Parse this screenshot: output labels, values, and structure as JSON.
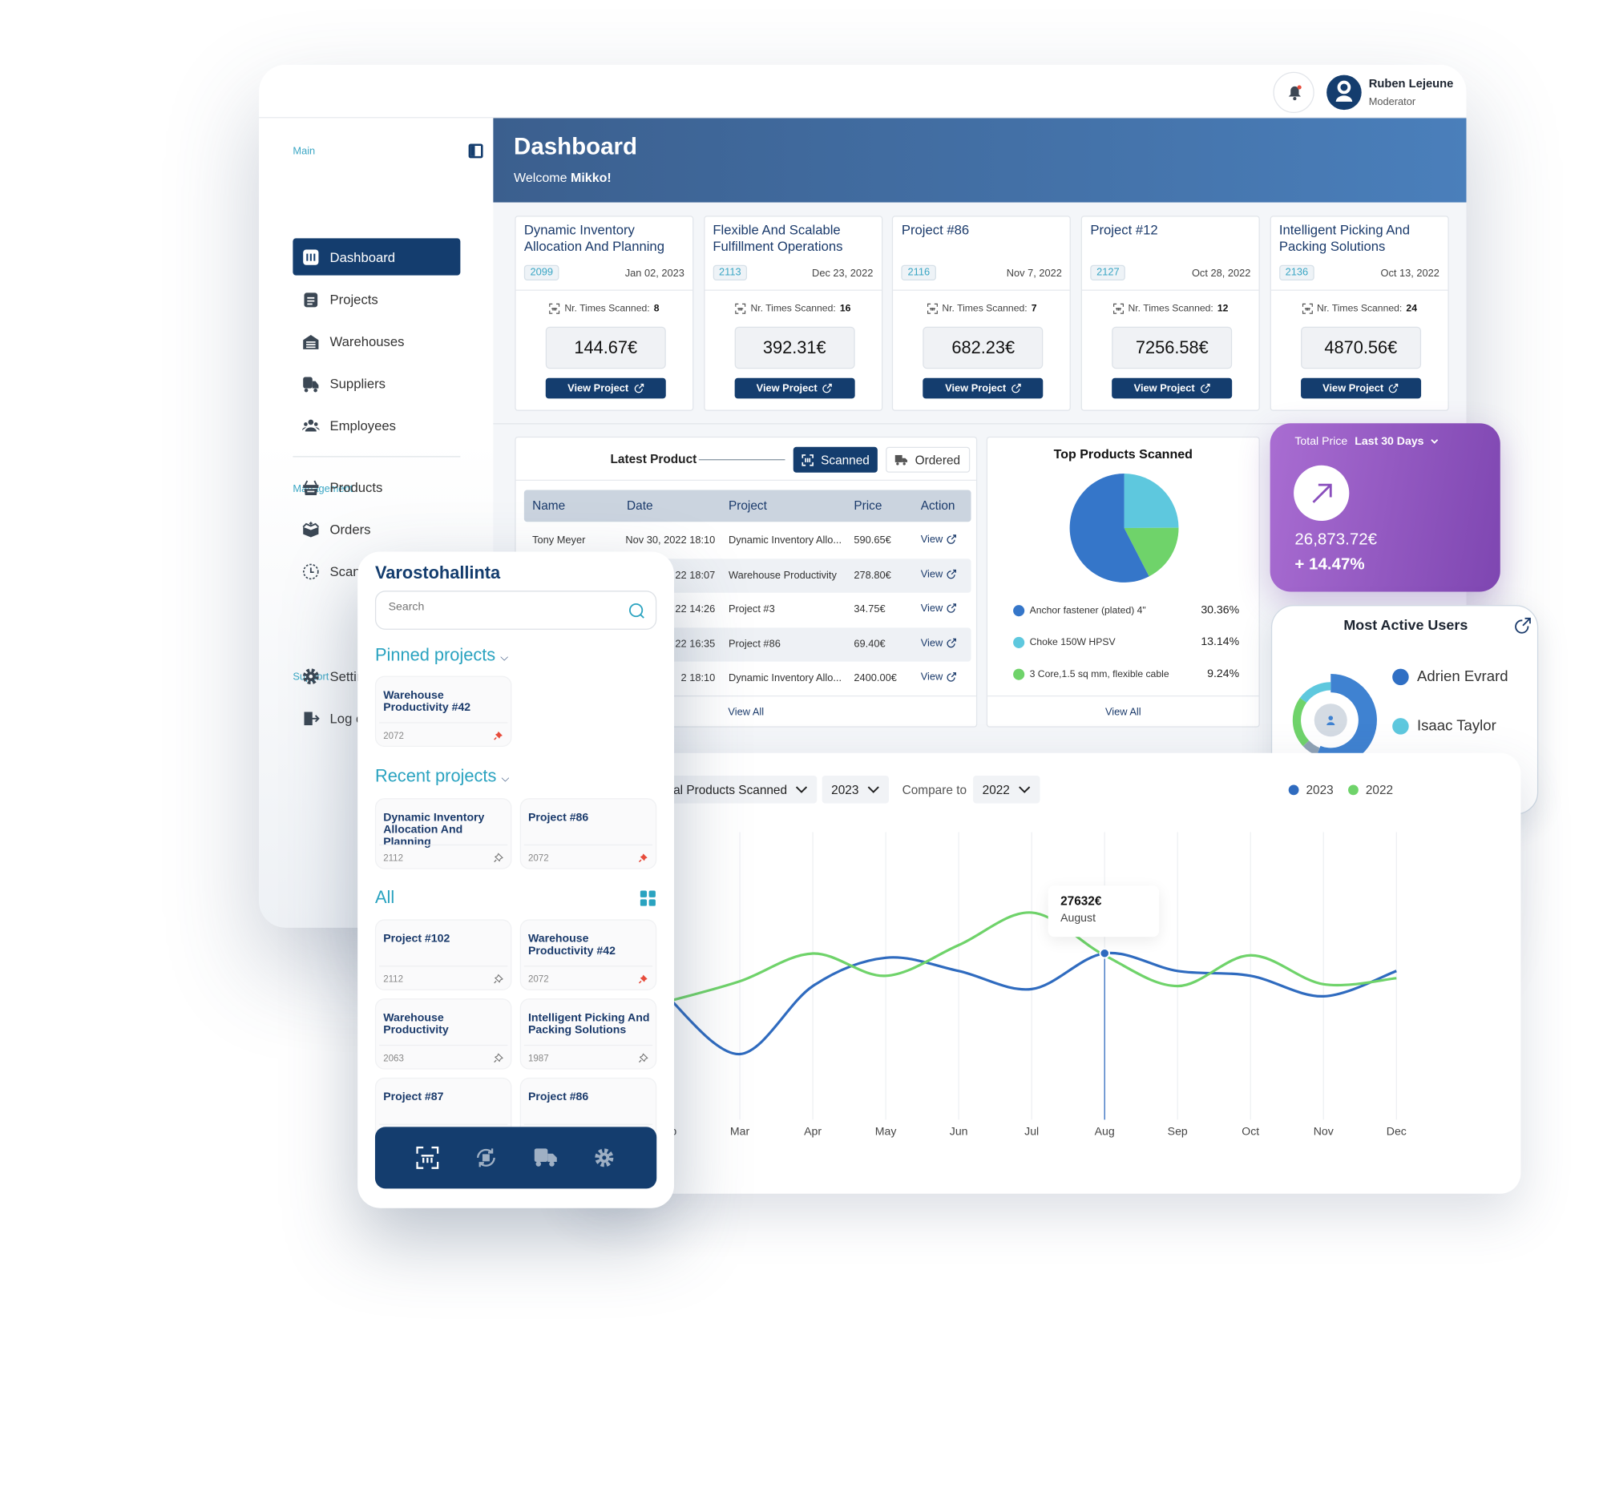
{
  "header": {
    "user_name": "Ruben Lejeune",
    "user_role": "Moderator",
    "icons": [
      "bell-icon",
      "avatar-icon"
    ],
    "notification_dot_color": "#e74c3c"
  },
  "sidebar": {
    "main_label": "Main",
    "management_label": "Management",
    "support_label": "Support",
    "main_items": [
      {
        "label": "Dashboard",
        "icon": "dashboard-icon",
        "active": true
      },
      {
        "label": "Projects",
        "icon": "clipboard-icon"
      },
      {
        "label": "Warehouses",
        "icon": "warehouse-icon"
      },
      {
        "label": "Suppliers",
        "icon": "truck-icon"
      },
      {
        "label": "Employees",
        "icon": "people-icon"
      }
    ],
    "management_items": [
      {
        "label": "Products",
        "icon": "basket-icon"
      },
      {
        "label": "Orders",
        "icon": "box-icon"
      },
      {
        "label": "Scanned History",
        "icon": "history-icon"
      }
    ],
    "support_items": [
      {
        "label": "Settings",
        "icon": "gear-icon"
      },
      {
        "label": "Log out",
        "icon": "logout-icon"
      }
    ]
  },
  "hero": {
    "title": "Dashboard",
    "welcome": "Welcome ",
    "user": "Mikko!"
  },
  "project_cards": [
    {
      "title": "Dynamic Inventory Allocation And Planning",
      "id": "2099",
      "date": "Jan 02, 2023",
      "scanned_label": "Nr. Times Scanned:",
      "scanned": "8",
      "price": "144.67€",
      "button": "View Project"
    },
    {
      "title": "Flexible And Scalable Fulfillment Operations",
      "id": "2113",
      "date": "Dec 23, 2022",
      "scanned_label": "Nr. Times Scanned:",
      "scanned": "16",
      "price": "392.31€",
      "button": "View Project"
    },
    {
      "title": "Project #86",
      "id": "2116",
      "date": "Nov 7, 2022",
      "scanned_label": "Nr. Times Scanned:",
      "scanned": "7",
      "price": "682.23€",
      "button": "View Project"
    },
    {
      "title": "Project #12",
      "id": "2127",
      "date": "Oct 28, 2022",
      "scanned_label": "Nr. Times Scanned:",
      "scanned": "12",
      "price": "7256.58€",
      "button": "View Project"
    },
    {
      "title": "Intelligent Picking And Packing Solutions",
      "id": "2136",
      "date": "Oct 13, 2022",
      "scanned_label": "Nr. Times Scanned:",
      "scanned": "24",
      "price": "4870.56€",
      "button": "View Project"
    }
  ],
  "latest": {
    "title": "Latest Product",
    "tab_scanned": "Scanned",
    "tab_ordered": "Ordered",
    "active_tab": "Scanned",
    "columns": [
      "Name",
      "Date",
      "Project",
      "Price",
      "Action"
    ],
    "rows": [
      {
        "name": "Tony Meyer",
        "date": "Nov 30, 2022 18:10",
        "project": "Dynamic Inventory Allo...",
        "price": "590.65€",
        "action": "View"
      },
      {
        "name": "",
        "date": "22 18:07",
        "project": "Warehouse Productivity",
        "price": "278.80€",
        "action": "View"
      },
      {
        "name": "",
        "date": "22 14:26",
        "project": "Project #3",
        "price": "34.75€",
        "action": "View"
      },
      {
        "name": "",
        "date": "22 16:35",
        "project": "Project #86",
        "price": "69.40€",
        "action": "View"
      },
      {
        "name": "",
        "date": "2 18:10",
        "project": "Dynamic Inventory Allo...",
        "price": "2400.00€",
        "action": "View"
      }
    ],
    "view_all": "View All"
  },
  "top_products": {
    "title": "Top Products Scanned",
    "view_all": "View All",
    "items": [
      {
        "name": "Anchor fastener (plated) 4\"",
        "pct": "30.36%",
        "value": 30.36,
        "color": "#3576c9"
      },
      {
        "name": "Choke 150W HPSV",
        "pct": "13.14%",
        "value": 13.14,
        "color": "#5ec8de"
      },
      {
        "name": "3 Core,1.5 sq mm, flexible cable",
        "pct": "9.24%",
        "value": 9.24,
        "color": "#6fd36a"
      }
    ]
  },
  "total_price": {
    "label": "Total Price ",
    "period": "Last 30 Days",
    "amount": "26,873.72€",
    "change": "+ 14.47%",
    "icon": "arrow-up-right-icon",
    "gradient": [
      "#a96dd2",
      "#7e46b1"
    ]
  },
  "active_users": {
    "title": "Most Active Users",
    "users": [
      {
        "name": "Adrien Evrard",
        "color": "#2f6fc4"
      },
      {
        "name": "Isaac Taylor",
        "color": "#5ec8de"
      }
    ],
    "donut_shares": [
      {
        "color": "#3f82d1",
        "share": 0.56
      },
      {
        "color": "#8fa2b5",
        "share": 0.07
      },
      {
        "color": "#6fd36a",
        "share": 0.22
      },
      {
        "color": "#5ec8de",
        "share": 0.15
      }
    ]
  },
  "chart_controls": {
    "metric": "Total Products Scanned",
    "year": "2023",
    "compare_label": "Compare to",
    "compare_year": "2022"
  },
  "chart_data": {
    "type": "line",
    "categories": [
      "Feb",
      "Mar",
      "Apr",
      "May",
      "Jun",
      "Jul",
      "Aug",
      "Sep",
      "Oct",
      "Nov",
      "Dec"
    ],
    "series": [
      {
        "name": "2023",
        "color": "#2f6bbf",
        "values": [
          20500,
          10900,
          22200,
          26900,
          24700,
          21700,
          27632,
          24700,
          23900,
          20500,
          24700
        ]
      },
      {
        "name": "2022",
        "color": "#6fd36a",
        "values": [
          19600,
          23000,
          27600,
          23900,
          29000,
          34400,
          27300,
          22200,
          27300,
          22500,
          23500
        ]
      }
    ],
    "legend": "top-right",
    "grid": "vertical",
    "tooltip": {
      "value": "27632€",
      "label": "August",
      "category": "Aug"
    }
  },
  "mobile": {
    "title": "Varostohallinta",
    "search_placeholder": "Search",
    "pinned_label": "Pinned projects",
    "recent_label": "Recent projects",
    "all_label": "All",
    "pinned": [
      {
        "title": "Warehouse Productivity #42",
        "id": "2072",
        "pinned": true
      }
    ],
    "recent": [
      {
        "title": "Dynamic Inventory Allocation And Planning",
        "id": "2112",
        "pinned": false
      },
      {
        "title": "Project #86",
        "id": "2072",
        "pinned": true
      }
    ],
    "all": [
      {
        "title": "Project #102",
        "id": "2112",
        "pinned": false
      },
      {
        "title": "Warehouse Productivity #42",
        "id": "2072",
        "pinned": true
      },
      {
        "title": "Warehouse Productivity",
        "id": "2063",
        "pinned": false
      },
      {
        "title": "Intelligent Picking And Packing Solutions",
        "id": "1987",
        "pinned": false
      },
      {
        "title": "Project #87",
        "id": "",
        "pinned": false
      },
      {
        "title": "Project #86",
        "id": "",
        "pinned": false
      }
    ],
    "bottom_nav": [
      "scan-icon",
      "refresh-box-icon",
      "delivery-truck-icon",
      "gear-icon"
    ],
    "accent": "#2aa3c0"
  }
}
